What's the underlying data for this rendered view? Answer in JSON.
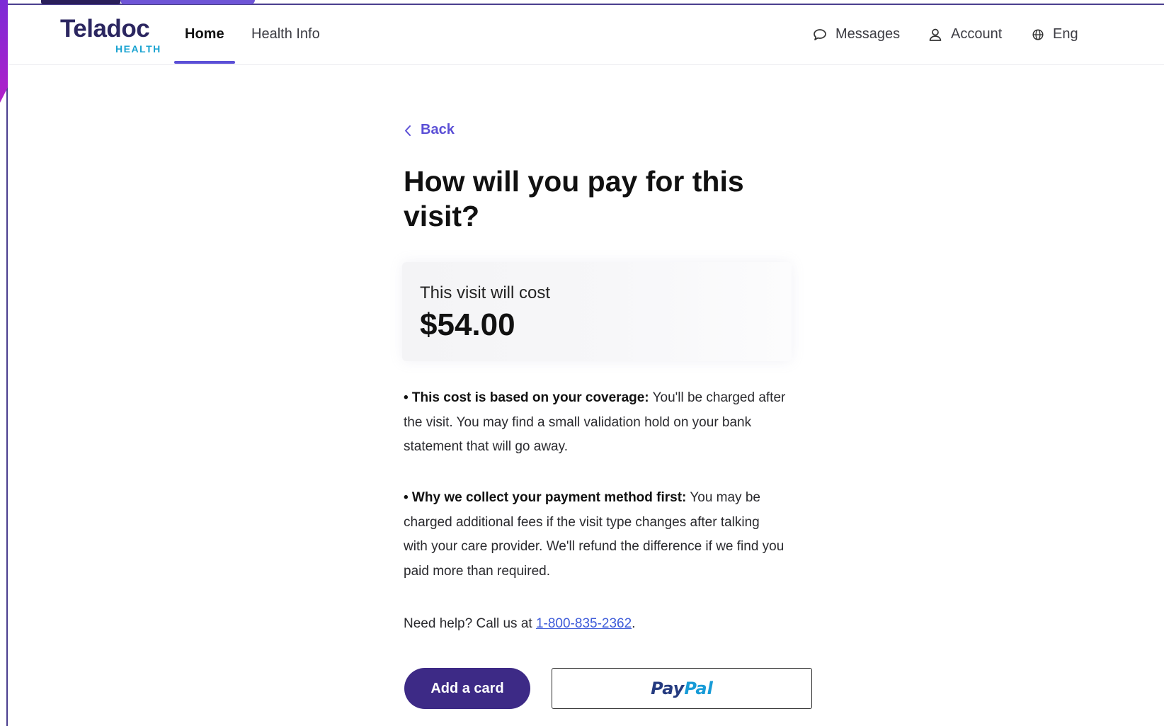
{
  "header": {
    "logo_text": "Teladoc",
    "logo_sub": "HEALTH",
    "tabs": [
      {
        "label": "Home"
      },
      {
        "label": "Health Info"
      }
    ],
    "right": {
      "messages": "Messages",
      "account": "Account",
      "language": "Eng"
    }
  },
  "page": {
    "back_label": "Back",
    "title": "How will you pay for this visit?",
    "cost_label": "This visit will cost",
    "cost_value": "$54.00",
    "bullet1_bold": "• This cost is based on your coverage:",
    "bullet1_text": " You'll be charged after the visit. You may find a small validation hold on your bank statement that will go away.",
    "bullet2_bold": "• Why we collect your payment method first:",
    "bullet2_text": " You may be charged additional fees if the visit type changes after talking with your care provider. We'll refund the difference if we find you paid more than required.",
    "help_text": "Need help? Call us at ",
    "help_phone": "1-800-835-2362",
    "help_end": ".",
    "add_card_label": "Add a card",
    "paypal_a": "Pay",
    "paypal_b": "Pal"
  },
  "colors": {
    "accent": "#5b4fd6",
    "primary_button": "#3d2a86",
    "brand_dark": "#2b2660",
    "brand_light": "#1aa3d1"
  }
}
